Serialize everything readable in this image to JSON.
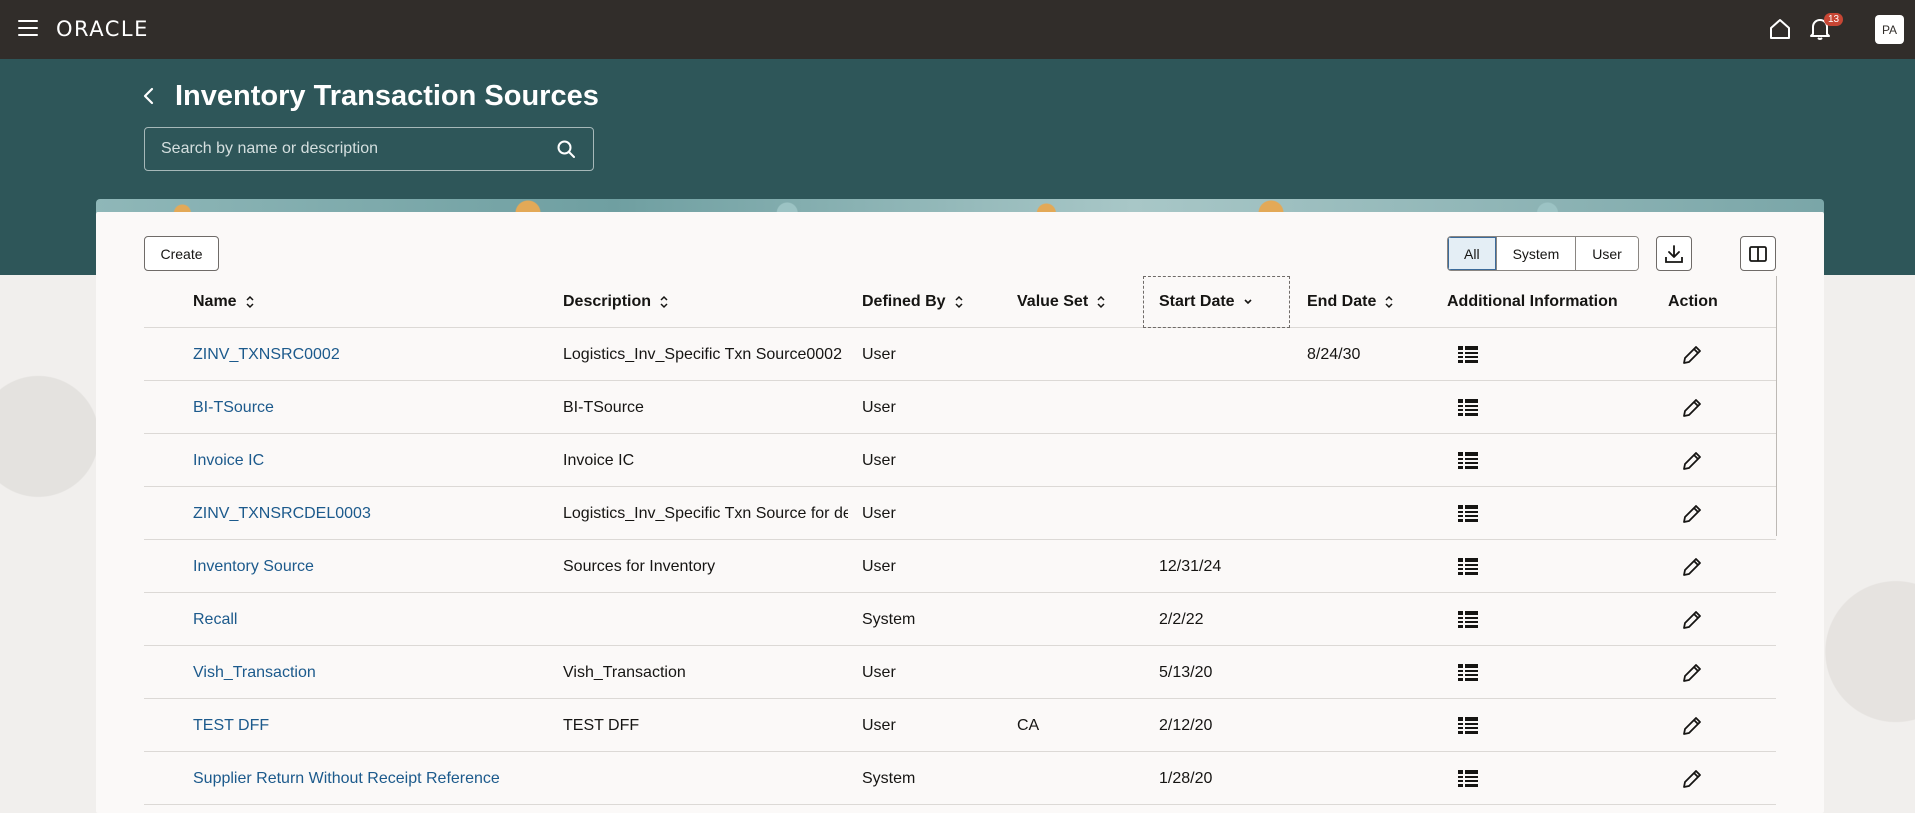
{
  "app": {
    "logo": "ORACLE",
    "notification_count": "13",
    "avatar_initials": "PA"
  },
  "page": {
    "title": "Inventory Transaction Sources"
  },
  "search": {
    "placeholder": "Search by name or description"
  },
  "toolbar": {
    "create_label": "Create",
    "filter_options": [
      "All",
      "System",
      "User"
    ],
    "selected_filter": "All"
  },
  "table": {
    "columns": [
      "Name",
      "Description",
      "Defined By",
      "Value Set",
      "Start Date",
      "End Date",
      "Additional Information",
      "Action"
    ],
    "rows": [
      {
        "name": "ZINV_TXNSRC0002",
        "description": "Logistics_Inv_Specific Txn Source0002",
        "defined_by": "User",
        "value_set": "",
        "start_date": "",
        "end_date": "8/24/30"
      },
      {
        "name": "BI-TSource",
        "description": "BI-TSource",
        "defined_by": "User",
        "value_set": "",
        "start_date": "",
        "end_date": ""
      },
      {
        "name": "Invoice IC",
        "description": "Invoice IC",
        "defined_by": "User",
        "value_set": "",
        "start_date": "",
        "end_date": ""
      },
      {
        "name": "ZINV_TXNSRCDEL0003",
        "description": "Logistics_Inv_Specific Txn Source for de",
        "defined_by": "User",
        "value_set": "",
        "start_date": "",
        "end_date": ""
      },
      {
        "name": "Inventory Source",
        "description": "Sources for Inventory",
        "defined_by": "User",
        "value_set": "",
        "start_date": "12/31/24",
        "end_date": ""
      },
      {
        "name": "Recall",
        "description": "",
        "defined_by": "System",
        "value_set": "",
        "start_date": "2/2/22",
        "end_date": ""
      },
      {
        "name": "Vish_Transaction",
        "description": "Vish_Transaction",
        "defined_by": "User",
        "value_set": "",
        "start_date": "5/13/20",
        "end_date": ""
      },
      {
        "name": "TEST DFF",
        "description": "TEST DFF",
        "defined_by": "User",
        "value_set": "CA",
        "start_date": "2/12/20",
        "end_date": ""
      },
      {
        "name": "Supplier Return Without Receipt Reference",
        "description": "",
        "defined_by": "System",
        "value_set": "",
        "start_date": "1/28/20",
        "end_date": ""
      }
    ]
  },
  "colors": {
    "topbar": "#312d2a",
    "band": "#2e5659",
    "link": "#1c5a8c",
    "badge": "#c74634"
  }
}
